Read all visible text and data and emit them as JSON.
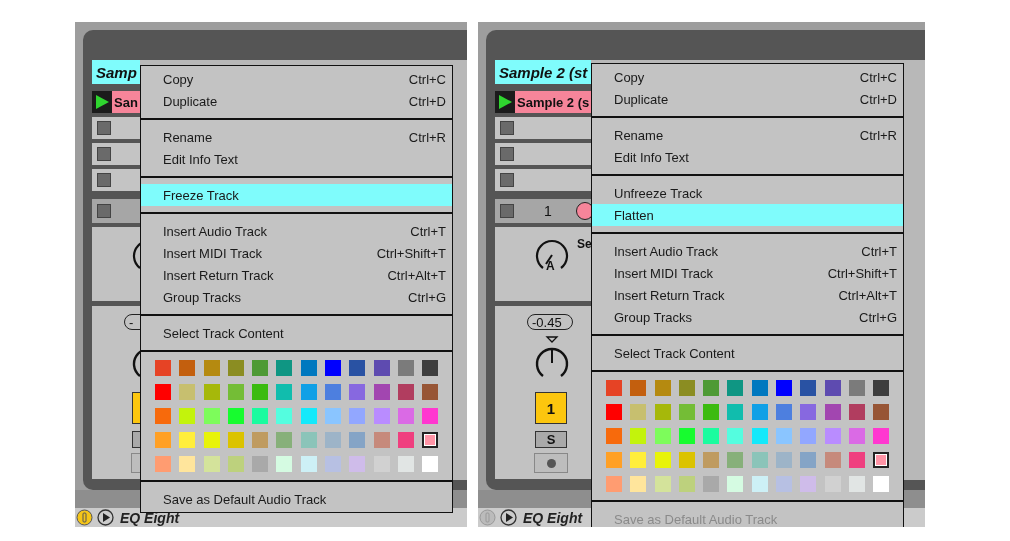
{
  "panels": [
    {
      "track_name": "Samp",
      "clip": {
        "name": "San",
        "playing": true
      },
      "track_row": {
        "checked": false
      },
      "mixer": {
        "volume": "-"
      },
      "device": {
        "name": "EQ Eight",
        "on": true
      },
      "menu": {
        "sections": [
          {
            "kind": "items",
            "items": [
              {
                "label": "Copy",
                "shortcut": "Ctrl+C",
                "selected": false,
                "disabled": false
              },
              {
                "label": "Duplicate",
                "shortcut": "Ctrl+D",
                "selected": false,
                "disabled": false
              }
            ]
          },
          {
            "kind": "items",
            "items": [
              {
                "label": "Rename",
                "shortcut": "Ctrl+R",
                "selected": false,
                "disabled": false
              },
              {
                "label": "Edit Info Text",
                "selected": false,
                "disabled": false
              }
            ]
          },
          {
            "kind": "items",
            "items": [
              {
                "label": "Freeze Track",
                "selected": true,
                "disabled": false
              }
            ]
          },
          {
            "kind": "items",
            "items": [
              {
                "label": "Insert Audio Track",
                "shortcut": "Ctrl+T",
                "selected": false,
                "disabled": false
              },
              {
                "label": "Insert MIDI Track",
                "shortcut": "Ctrl+Shift+T",
                "selected": false,
                "disabled": false
              },
              {
                "label": "Insert Return Track",
                "shortcut": "Ctrl+Alt+T",
                "selected": false,
                "disabled": false
              },
              {
                "label": "Group Tracks",
                "shortcut": "Ctrl+G",
                "selected": false,
                "disabled": false
              }
            ]
          },
          {
            "kind": "items",
            "items": [
              {
                "label": "Select Track Content",
                "selected": false,
                "disabled": false
              }
            ]
          },
          {
            "kind": "palette",
            "rows": [
              [
                {
                  "color": "#e64325",
                  "selected": false
                },
                {
                  "color": "#c35f0e",
                  "selected": false
                },
                {
                  "color": "#b58a10",
                  "selected": false
                },
                {
                  "color": "#8b8d22",
                  "selected": false
                },
                {
                  "color": "#4e9a35",
                  "selected": false
                },
                {
                  "color": "#0f9683",
                  "selected": false
                },
                {
                  "color": "#0078bf",
                  "selected": false
                },
                {
                  "color": "#0000ff",
                  "selected": false
                },
                {
                  "color": "#2952a3",
                  "selected": false
                },
                {
                  "color": "#5e4bb0",
                  "selected": false
                },
                {
                  "color": "#7b7b7b",
                  "selected": false
                },
                {
                  "color": "#3d3d3d",
                  "selected": false
                }
              ],
              [
                {
                  "color": "#ff0000",
                  "selected": false
                },
                {
                  "color": "#c7bf6f",
                  "selected": false
                },
                {
                  "color": "#a6b80a",
                  "selected": false
                },
                {
                  "color": "#74bd36",
                  "selected": false
                },
                {
                  "color": "#3cbb10",
                  "selected": false
                },
                {
                  "color": "#11bdad",
                  "selected": false
                },
                {
                  "color": "#10a0e6",
                  "selected": false
                },
                {
                  "color": "#4d7fdf",
                  "selected": false
                },
                {
                  "color": "#8768e0",
                  "selected": false
                },
                {
                  "color": "#a246b0",
                  "selected": false
                },
                {
                  "color": "#b13d5f",
                  "selected": false
                },
                {
                  "color": "#975535",
                  "selected": false
                }
              ],
              [
                {
                  "color": "#f76a0c",
                  "selected": false
                },
                {
                  "color": "#c3f30c",
                  "selected": false
                },
                {
                  "color": "#7dfc5b",
                  "selected": false
                },
                {
                  "color": "#17fc2f",
                  "selected": false
                },
                {
                  "color": "#1afc9f",
                  "selected": false
                },
                {
                  "color": "#54fddf",
                  "selected": false
                },
                {
                  "color": "#14e9fb",
                  "selected": false
                },
                {
                  "color": "#8ac5ff",
                  "selected": false
                },
                {
                  "color": "#92a7ff",
                  "selected": false
                },
                {
                  "color": "#b98cff",
                  "selected": false
                },
                {
                  "color": "#da6ae5",
                  "selected": false
                },
                {
                  "color": "#ff37d0",
                  "selected": false
                }
              ],
              [
                {
                  "color": "#ffa025",
                  "selected": false
                },
                {
                  "color": "#ffee3b",
                  "selected": false
                },
                {
                  "color": "#e8f309",
                  "selected": false
                },
                {
                  "color": "#dbc300",
                  "selected": false
                },
                {
                  "color": "#bf9b60",
                  "selected": false
                },
                {
                  "color": "#87b07a",
                  "selected": false
                },
                {
                  "color": "#8bc4b9",
                  "selected": false
                },
                {
                  "color": "#9db4c8",
                  "selected": false
                },
                {
                  "color": "#85a4c6",
                  "selected": false
                },
                {
                  "color": "#c68a7c",
                  "selected": false
                },
                {
                  "color": "#ef3f7f",
                  "selected": false
                },
                {
                  "color": "#ff94a6",
                  "selected": true
                }
              ],
              [
                {
                  "color": "#ff9c71",
                  "selected": false
                },
                {
                  "color": "#ffe59c",
                  "selected": false
                },
                {
                  "color": "#d4e39b",
                  "selected": false
                },
                {
                  "color": "#bdd17d",
                  "selected": false
                },
                {
                  "color": "#a9a9a9",
                  "selected": false
                },
                {
                  "color": "#d5fbe2",
                  "selected": false
                },
                {
                  "color": "#cdf0f6",
                  "selected": false
                },
                {
                  "color": "#b7c0e3",
                  "selected": false
                },
                {
                  "color": "#cfbcea",
                  "selected": false
                },
                {
                  "color": "#d1d1d1",
                  "selected": false
                },
                {
                  "color": "#e1e5e4",
                  "selected": false
                },
                {
                  "color": "#ffffff",
                  "selected": false
                }
              ]
            ]
          },
          {
            "kind": "items",
            "items": [
              {
                "label": "Save as Default Audio Track",
                "selected": false,
                "disabled": false
              }
            ]
          }
        ]
      }
    },
    {
      "track_name": "Sample 2 (st",
      "clip": {
        "name": "Sample 2 (s",
        "playing": true
      },
      "track_row": {
        "number": "1",
        "checked": false
      },
      "send": {
        "label": "A",
        "name": "Se"
      },
      "mixer": {
        "volume": "-0.45",
        "activator_label": "1",
        "solo_label": "S"
      },
      "device": {
        "name": "EQ Eight",
        "on": false
      },
      "menu": {
        "sections": [
          {
            "kind": "items",
            "items": [
              {
                "label": "Copy",
                "shortcut": "Ctrl+C",
                "selected": false,
                "disabled": false
              },
              {
                "label": "Duplicate",
                "shortcut": "Ctrl+D",
                "selected": false,
                "disabled": false
              }
            ]
          },
          {
            "kind": "items",
            "items": [
              {
                "label": "Rename",
                "shortcut": "Ctrl+R",
                "selected": false,
                "disabled": false
              },
              {
                "label": "Edit Info Text",
                "selected": false,
                "disabled": false
              }
            ]
          },
          {
            "kind": "items",
            "items": [
              {
                "label": "Unfreeze Track",
                "selected": false,
                "disabled": false
              },
              {
                "label": "Flatten",
                "selected": true,
                "disabled": false
              }
            ]
          },
          {
            "kind": "items",
            "items": [
              {
                "label": "Insert Audio Track",
                "shortcut": "Ctrl+T",
                "selected": false,
                "disabled": false
              },
              {
                "label": "Insert MIDI Track",
                "shortcut": "Ctrl+Shift+T",
                "selected": false,
                "disabled": false
              },
              {
                "label": "Insert Return Track",
                "shortcut": "Ctrl+Alt+T",
                "selected": false,
                "disabled": false
              },
              {
                "label": "Group Tracks",
                "shortcut": "Ctrl+G",
                "selected": false,
                "disabled": false
              }
            ]
          },
          {
            "kind": "items",
            "items": [
              {
                "label": "Select Track Content",
                "selected": false,
                "disabled": false
              }
            ]
          },
          {
            "kind": "palette",
            "rows": [
              [
                {
                  "color": "#e64325",
                  "selected": false
                },
                {
                  "color": "#c35f0e",
                  "selected": false
                },
                {
                  "color": "#b58a10",
                  "selected": false
                },
                {
                  "color": "#8b8d22",
                  "selected": false
                },
                {
                  "color": "#4e9a35",
                  "selected": false
                },
                {
                  "color": "#0f9683",
                  "selected": false
                },
                {
                  "color": "#0078bf",
                  "selected": false
                },
                {
                  "color": "#0000ff",
                  "selected": false
                },
                {
                  "color": "#2952a3",
                  "selected": false
                },
                {
                  "color": "#5e4bb0",
                  "selected": false
                },
                {
                  "color": "#7b7b7b",
                  "selected": false
                },
                {
                  "color": "#3d3d3d",
                  "selected": false
                }
              ],
              [
                {
                  "color": "#ff0000",
                  "selected": false
                },
                {
                  "color": "#c7bf6f",
                  "selected": false
                },
                {
                  "color": "#a6b80a",
                  "selected": false
                },
                {
                  "color": "#74bd36",
                  "selected": false
                },
                {
                  "color": "#3cbb10",
                  "selected": false
                },
                {
                  "color": "#11bdad",
                  "selected": false
                },
                {
                  "color": "#10a0e6",
                  "selected": false
                },
                {
                  "color": "#4d7fdf",
                  "selected": false
                },
                {
                  "color": "#8768e0",
                  "selected": false
                },
                {
                  "color": "#a246b0",
                  "selected": false
                },
                {
                  "color": "#b13d5f",
                  "selected": false
                },
                {
                  "color": "#975535",
                  "selected": false
                }
              ],
              [
                {
                  "color": "#f76a0c",
                  "selected": false
                },
                {
                  "color": "#c3f30c",
                  "selected": false
                },
                {
                  "color": "#7dfc5b",
                  "selected": false
                },
                {
                  "color": "#17fc2f",
                  "selected": false
                },
                {
                  "color": "#1afc9f",
                  "selected": false
                },
                {
                  "color": "#54fddf",
                  "selected": false
                },
                {
                  "color": "#14e9fb",
                  "selected": false
                },
                {
                  "color": "#8ac5ff",
                  "selected": false
                },
                {
                  "color": "#92a7ff",
                  "selected": false
                },
                {
                  "color": "#b98cff",
                  "selected": false
                },
                {
                  "color": "#da6ae5",
                  "selected": false
                },
                {
                  "color": "#ff37d0",
                  "selected": false
                }
              ],
              [
                {
                  "color": "#ffa025",
                  "selected": false
                },
                {
                  "color": "#ffee3b",
                  "selected": false
                },
                {
                  "color": "#e8f309",
                  "selected": false
                },
                {
                  "color": "#dbc300",
                  "selected": false
                },
                {
                  "color": "#bf9b60",
                  "selected": false
                },
                {
                  "color": "#87b07a",
                  "selected": false
                },
                {
                  "color": "#8bc4b9",
                  "selected": false
                },
                {
                  "color": "#9db4c8",
                  "selected": false
                },
                {
                  "color": "#85a4c6",
                  "selected": false
                },
                {
                  "color": "#c68a7c",
                  "selected": false
                },
                {
                  "color": "#ef3f7f",
                  "selected": false
                },
                {
                  "color": "#ff94a6",
                  "selected": true
                }
              ],
              [
                {
                  "color": "#ff9c71",
                  "selected": false
                },
                {
                  "color": "#ffe59c",
                  "selected": false
                },
                {
                  "color": "#d4e39b",
                  "selected": false
                },
                {
                  "color": "#bdd17d",
                  "selected": false
                },
                {
                  "color": "#a9a9a9",
                  "selected": false
                },
                {
                  "color": "#d5fbe2",
                  "selected": false
                },
                {
                  "color": "#cdf0f6",
                  "selected": false
                },
                {
                  "color": "#b7c0e3",
                  "selected": false
                },
                {
                  "color": "#cfbcea",
                  "selected": false
                },
                {
                  "color": "#d1d1d1",
                  "selected": false
                },
                {
                  "color": "#e1e5e4",
                  "selected": false
                },
                {
                  "color": "#ffffff",
                  "selected": false
                }
              ]
            ]
          },
          {
            "kind": "items",
            "items": [
              {
                "label": "Save as Default Audio Track",
                "selected": false,
                "disabled": true
              }
            ]
          }
        ]
      }
    }
  ]
}
